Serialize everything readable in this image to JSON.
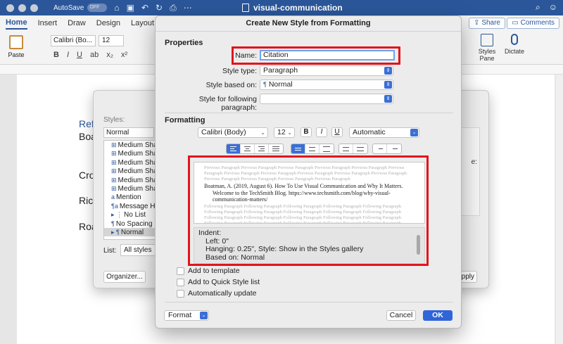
{
  "titlebar": {
    "autosave_label": "AutoSave",
    "autosave_state": "OFF",
    "doc_title": "visual-communication"
  },
  "ribbon": {
    "tabs": [
      "Home",
      "Insert",
      "Draw",
      "Design",
      "Layout"
    ],
    "share_label": "Share",
    "comments_label": "Comments",
    "paste_label": "Paste",
    "font_name": "Calibri (Bo...",
    "font_size": "12",
    "styles_pane_label": "Styles Pane",
    "dictate_label": "Dictate"
  },
  "document": {
    "lines": [
      "Ref",
      "Boa",
      "Cro",
      "Rick",
      "Roa"
    ]
  },
  "styles_dialog": {
    "styles_label": "Styles:",
    "current_style": "Normal",
    "items": [
      {
        "glyph": "⊞",
        "label": "Medium Shac"
      },
      {
        "glyph": "⊞",
        "label": "Medium Shac"
      },
      {
        "glyph": "⊞",
        "label": "Medium Shac"
      },
      {
        "glyph": "⊞",
        "label": "Medium Shac"
      },
      {
        "glyph": "⊞",
        "label": "Medium Shac"
      },
      {
        "glyph": "⊞",
        "label": "Medium Shac"
      },
      {
        "glyph": "a",
        "label": "Mention"
      },
      {
        "glyph": "¶a",
        "label": "Message Hea"
      },
      {
        "glyph": "▸ ⋮",
        "label": "No List"
      },
      {
        "glyph": "¶",
        "label": "No Spacing"
      },
      {
        "glyph": "▸ ¶",
        "label": "Normal"
      }
    ],
    "list_label": "List:",
    "list_value": "All styles",
    "organizer_label": "Organizer...",
    "apply_label": "pply",
    "side_text": "e:"
  },
  "dialog": {
    "title": "Create New Style from Formatting",
    "properties_heading": "Properties",
    "name_label": "Name:",
    "name_value": "Citation",
    "style_type_label": "Style type:",
    "style_type_value": "Paragraph",
    "based_on_label": "Style based on:",
    "based_on_value": "Normal",
    "following_label": "Style for following paragraph:",
    "following_value": "",
    "formatting_heading": "Formatting",
    "font_value": "Calibri (Body)",
    "size_value": "12",
    "bold_label": "B",
    "italic_label": "I",
    "underline_label": "U",
    "color_value": "Automatic",
    "preview_prev": "Previous Paragraph Previous Paragraph Previous Paragraph Previous Paragraph Previous Paragraph Previous Paragraph Previous Paragraph Previous Paragraph Previous Paragraph Previous Paragraph Previous Paragraph Previous Paragraph Previous Paragraph Previous Paragraph Previous Paragraph",
    "preview_main_1": "Boatman, A. (2019, August 6). How To Use Visual Communication and Why It Matters.",
    "preview_main_2": "Welcome to the TechSmith Blog. https://www.techsmith.com/blog/why-visual-",
    "preview_main_3": "communication-matters/",
    "preview_next": "Following Paragraph Following Paragraph Following Paragraph Following Paragraph Following Paragraph Following Paragraph Following Paragraph Following Paragraph Following Paragraph Following Paragraph Following Paragraph Following Paragraph Following Paragraph Following Paragraph Following Paragraph Following Paragraph Following Paragraph Following Paragraph Following Paragraph Following Paragraph Following Paragraph Following Paragraph Following Paragraph Following Paragraph Following Paragraph Following Paragraph Following Paragraph Following Paragraph Following Paragraph Following Paragraph",
    "desc_1": "Indent:",
    "desc_2": "Left:  0\"",
    "desc_3": "Hanging:  0.25\", Style: Show in the Styles gallery",
    "desc_4": "Based on: Normal",
    "add_template_label": "Add to template",
    "add_quick_label": "Add to Quick Style list",
    "auto_update_label": "Automatically update",
    "format_label": "Format",
    "cancel_label": "Cancel",
    "ok_label": "OK"
  },
  "colors": {
    "titlebar": "#2b579a",
    "highlight": "#e1141b",
    "accent": "#2f65d8"
  }
}
